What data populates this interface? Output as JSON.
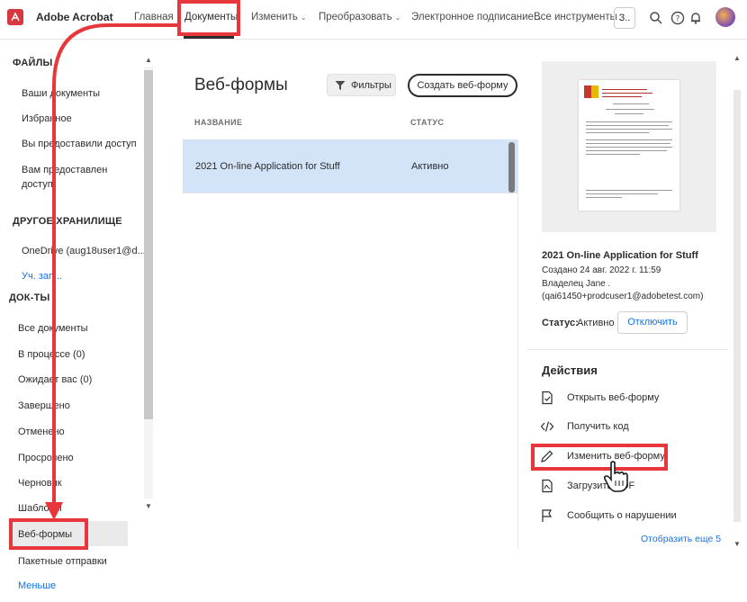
{
  "app": {
    "brand": "Adobe Acrobat"
  },
  "nav": {
    "items": [
      {
        "label": "Главная",
        "chevron": false
      },
      {
        "label": "Документы",
        "chevron": false
      },
      {
        "label": "Изменить",
        "chevron": true
      },
      {
        "label": "Преобразовать",
        "chevron": true
      },
      {
        "label": "Электронное подписание",
        "chevron": true
      },
      {
        "label": "Все инструменты",
        "chevron": false
      }
    ],
    "active": "Документы",
    "tools_box": "З.."
  },
  "sidebar": {
    "section_files": "ФАЙЛЫ",
    "files": [
      "Ваши документы",
      "Избранное",
      "Вы предоставили доступ",
      "Вам предоставлен",
      "доступ"
    ],
    "section_other": "ДРУГОЕ ХРАНИЛИЩЕ",
    "onedrive": "OneDrive (aug18user1@d...",
    "account_link": "Уч. зап...",
    "section_docs": "ДОК-ТЫ",
    "docs": [
      "Все документы",
      "В процессе (0)",
      "Ожидает вас (0)",
      "Завершено",
      "Отменено",
      "Просрочено",
      "Черновик",
      "Шаблоны"
    ],
    "selected": "Веб-формы",
    "after": [
      "Пакетные отправки"
    ],
    "less_link": "Меньше"
  },
  "main": {
    "title": "Веб-формы",
    "filters_label": "Фильтры",
    "create_label": "Создать веб-форму",
    "col_name": "НАЗВАНИЕ",
    "col_status": "СТАТУС",
    "rows": [
      {
        "name": "2021 On-line Application for Stuff",
        "status": "Активно"
      }
    ]
  },
  "details": {
    "title": "2021 On-line Application for Stuff",
    "created": "Создано 24 авг. 2022 г. 11:59",
    "owner": "Владелец Jane .",
    "email": "(qai61450+prodcuser1@adobetest.com)",
    "status_label": "Статус:",
    "status_value": "Активно",
    "disable_label": "Отключить",
    "actions_title": "Действия",
    "actions": [
      {
        "label": "Открыть веб-форму",
        "icon": "open-form-icon"
      },
      {
        "label": "Получить код",
        "icon": "code-icon"
      },
      {
        "label": "Изменить веб-форму",
        "icon": "pencil-icon"
      },
      {
        "label": "Загрузить PDF",
        "icon": "pdf-download-icon"
      },
      {
        "label": "Сообщить о нарушении",
        "icon": "flag-icon"
      }
    ],
    "show_more": "Отобразить еще 5"
  },
  "colors": {
    "accent": "#1473e6",
    "selection": "#d3e3f8",
    "annotation_red": "#e8363d",
    "brand_red": "#d7373f"
  }
}
